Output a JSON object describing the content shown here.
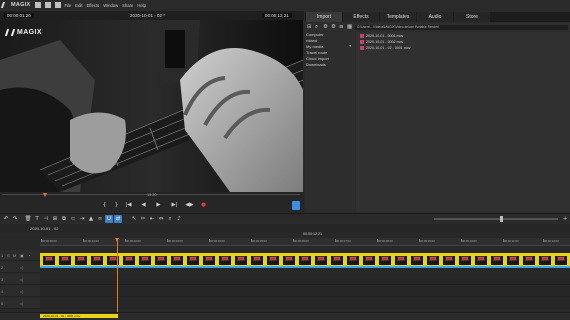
{
  "app": {
    "brand": "MAGIX"
  },
  "menu": [
    "File",
    "Edit",
    "Effects",
    "Window",
    "Share",
    "Help"
  ],
  "player": {
    "timecode_left": "00:00:01:20",
    "project_title": "2020-10-01 - 02 *",
    "timecode_right": "00:00:12:21",
    "watermark": "MAGIX",
    "scrub_position": "15:20",
    "playhead_fraction": 0.14
  },
  "transport": {
    "buttons": [
      "{",
      "}",
      "|◀",
      "◀",
      "▶",
      "▶|",
      "◀▶",
      "●"
    ],
    "accent": "#3f8fe0",
    "record_color": "#e23a3a"
  },
  "panel": {
    "tabs": [
      "Import",
      "Effects",
      "Templates",
      "Audio",
      "Store"
    ],
    "active_tab": "Import",
    "path": "C:\\Users\\...\\Videos\\MAGIX\\Video deluxe Portable Render\\",
    "nav": [
      "Computer",
      "roland",
      "My media",
      "Travel route",
      "Cloud Import",
      "Downloads"
    ],
    "files": [
      "2020-10-01 - 0001.mov",
      "2020-10-01 - 0002.mov",
      "2020-10-01 - 02 - 0001.mov"
    ],
    "file_color": "#c2446a"
  },
  "timeline": {
    "project_name": "2020-10-01 - 02",
    "timecode": "00:00:12:21",
    "ruler": [
      "00:00:00:00",
      "00:00:01:00",
      "00:00:02:00",
      "00:00:03:00",
      "00:00:04:00",
      "00:00:05:00",
      "00:00:06:00",
      "00:00:07:00",
      "00:00:08:00",
      "00:00:09:00",
      "00:00:10:00",
      "00:00:11:00",
      "00:00:12:00"
    ],
    "tracks": [
      "1",
      "2",
      "3",
      "4",
      "5"
    ],
    "clip_label": "2020-10-01 - 02 - 0001.mov",
    "clip_color": "#e8d31a",
    "playhead_color": "#e0792a"
  }
}
